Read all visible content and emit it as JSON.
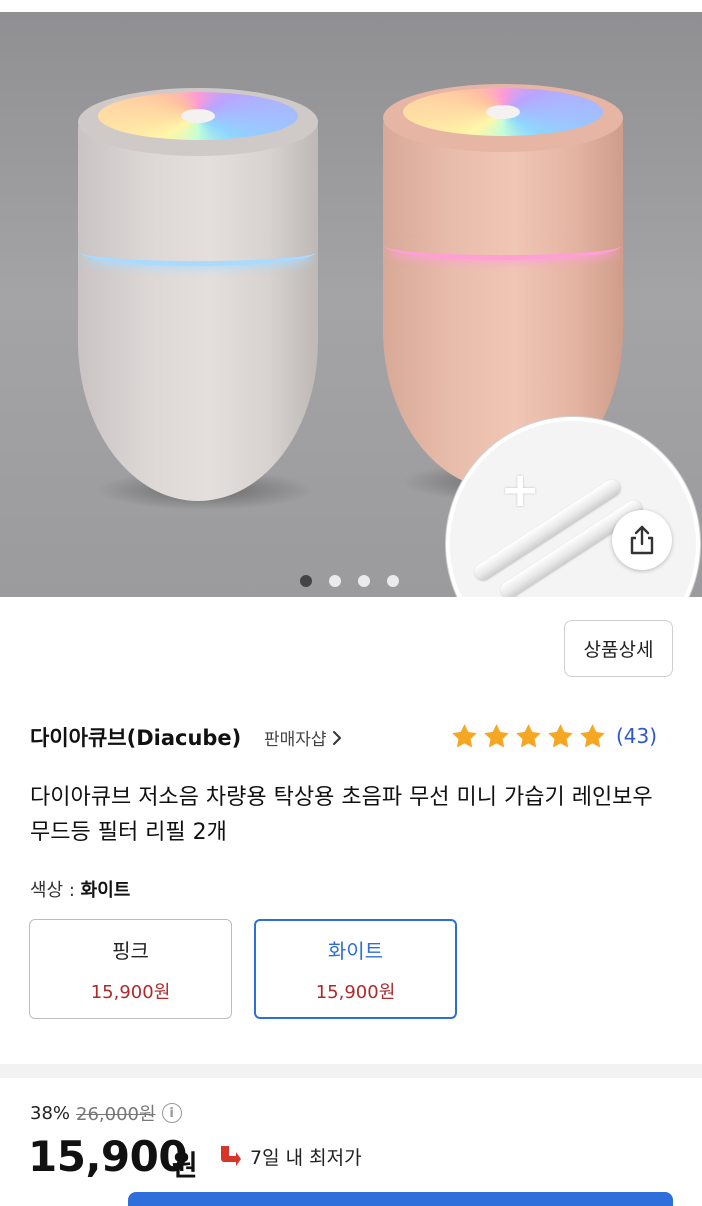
{
  "gallery": {
    "dots": [
      true,
      false,
      false,
      false
    ],
    "plus_label": "+"
  },
  "actions": {
    "detail_button": "상품상세"
  },
  "seller": {
    "name": "다이아큐브(Diacube)",
    "shop_link": "판매자샵"
  },
  "rating": {
    "stars": 5,
    "count": "(43)",
    "star_color": "#f5a623"
  },
  "product": {
    "title": "다이아큐브 저소음 차량용 탁상용 초음파 무선 미니 가습기 레인보우 무드등 필터 리필 2개"
  },
  "options": {
    "label": "색상 : ",
    "selected": "화이트",
    "items": [
      {
        "name": "핑크",
        "price": "15,900원"
      },
      {
        "name": "화이트",
        "price": "15,900원"
      }
    ]
  },
  "pricing": {
    "discount": "38%",
    "original": "26,000원",
    "price": "15,900",
    "unit": "원",
    "badge": "7일 내 최저가",
    "accent": "#2d6fd6",
    "price_color": "#b02a2a"
  }
}
